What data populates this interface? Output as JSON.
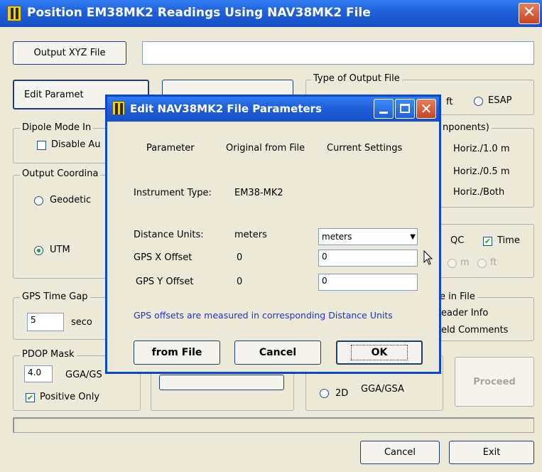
{
  "window": {
    "title": "Position EM38MK2 Readings Using NAV38MK2 File",
    "close_glyph": "✕"
  },
  "main": {
    "output_xyz_button": "Output XYZ File",
    "output_path": "",
    "edit_params_button": "Edit Paramet",
    "type_output_group": "Type of Output File",
    "type_output_partial": "ft",
    "type_output_esap": "ESAP",
    "dipole_group": "Dipole Mode In",
    "disable_auto_label": "Disable Au",
    "components_group": "nponents)",
    "horiz_1m": "Horiz./1.0 m",
    "horiz_05m": "Horiz./0.5 m",
    "horiz_both": "Horiz./Both",
    "output_coord_group": "Output Coordina",
    "geodetic_label": "Geodetic",
    "utm_label": "UTM",
    "qc_label": "QC",
    "time_label": "Time",
    "m_label": "m",
    "ft_label": "ft",
    "gps_time_gap_group": "GPS Time Gap",
    "gps_time_gap_value": "5",
    "seconds_label": "seco",
    "file_group": "e in File",
    "header_info_label": "eader Info",
    "field_comments_label": "eld Comments",
    "pdop_group": "PDOP Mask",
    "pdop_value": "4.0",
    "gga_gs_label": "GGA/GS",
    "positive_only_label": "Positive Only",
    "two_d_label": "2D",
    "gga_gsa_label": "GGA/GSA",
    "proceed_button": "Proceed",
    "cancel_button": "Cancel",
    "exit_button": "Exit"
  },
  "dialog": {
    "title": "Edit NAV38MK2 File Parameters",
    "col_parameter": "Parameter",
    "col_original": "Original from File",
    "col_current": "Current Settings",
    "instrument_type_label": "Instrument Type:",
    "instrument_type_value": "EM38-MK2",
    "distance_units_label": "Distance Units:",
    "distance_units_original": "meters",
    "distance_units_selected": "meters",
    "gps_x_offset_label": "GPS X Offset",
    "gps_x_offset_original": "0",
    "gps_x_offset_value": "0",
    "gps_y_offset_label": "GPS Y Offset",
    "gps_y_offset_original": "0",
    "gps_y_offset_value": "0",
    "note": "GPS offsets are measured in corresponding Distance Units",
    "from_file_button": "from File",
    "cancel_button": "Cancel",
    "ok_button": "OK"
  },
  "colors": {
    "titlebar": "#1f5fd8",
    "window_bg": "#ece9d8",
    "note_text": "#1e35c8",
    "close_red": "#c74424"
  }
}
